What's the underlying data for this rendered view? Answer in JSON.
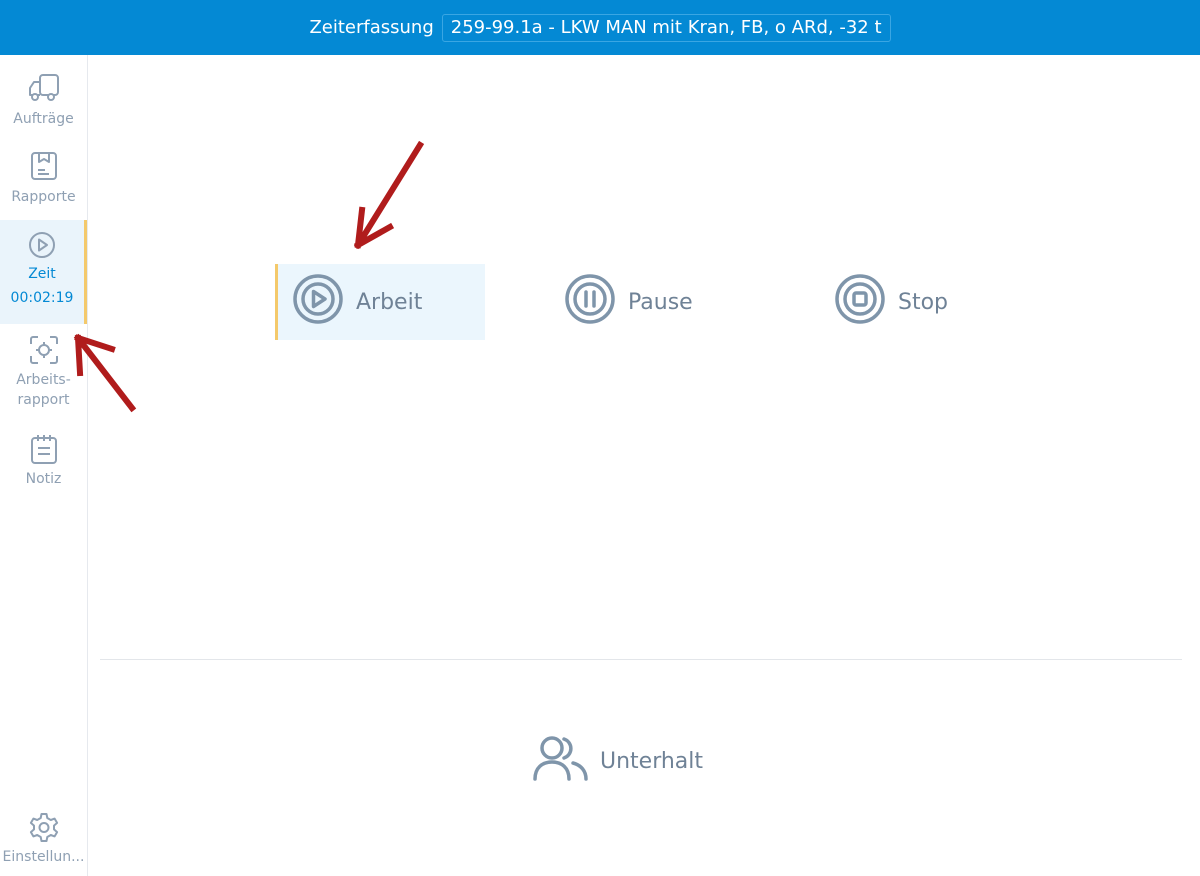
{
  "header": {
    "title": "Zeiterfassung",
    "vehicle": "259-99.1a - LKW MAN mit Kran, FB, o ARd, -32 t"
  },
  "sidebar": {
    "items": [
      {
        "label": "Aufträge",
        "icon": "truck-icon"
      },
      {
        "label": "Rapporte",
        "icon": "report-icon"
      },
      {
        "label": "Zeit",
        "icon": "play-circle-icon",
        "timer": "00:02:19",
        "active": true
      },
      {
        "label": "Arbeits-",
        "label2": "rapport",
        "icon": "scan-target-icon"
      },
      {
        "label": "Notiz",
        "icon": "notepad-icon"
      }
    ],
    "settings": {
      "label": "Einstellun...",
      "icon": "gear-icon"
    }
  },
  "actions": {
    "work": "Arbeit",
    "pause": "Pause",
    "stop": "Stop"
  },
  "maintenance": {
    "label": "Unterhalt",
    "icon": "users-icon"
  },
  "colors": {
    "header_bg": "#0489d4",
    "accent": "#0489d4",
    "active_border": "#f4c96b",
    "icon_gray": "#8fa0b3",
    "annotation_arrow": "#b01c1c"
  }
}
